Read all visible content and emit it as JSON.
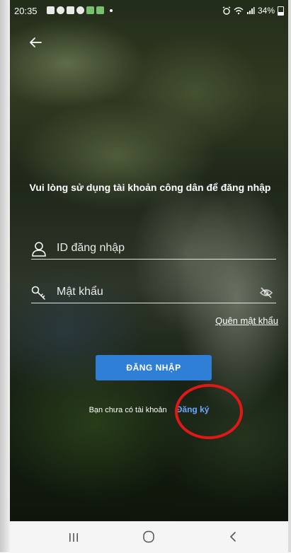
{
  "status_bar": {
    "time": "20:35",
    "battery": "34%"
  },
  "icons": {
    "back": "arrow-left-icon",
    "user": "user-icon",
    "key": "key-icon",
    "eye": "eye-off-icon"
  },
  "login": {
    "prompt": "Vui lòng sử dụng tài khoản công dân để đăng nhập",
    "username_placeholder": "ID đăng nhập",
    "password_placeholder": "Mật khẩu",
    "forgot_password": "Quên mật khẩu",
    "submit_label": "ĐĂNG NHẬP",
    "no_account": "Bạn chưa có tài khoản",
    "register": "Đăng ký"
  },
  "colors": {
    "button": "#2f7fd6",
    "link": "#6aa9ff",
    "highlight_ring": "#e01818"
  }
}
